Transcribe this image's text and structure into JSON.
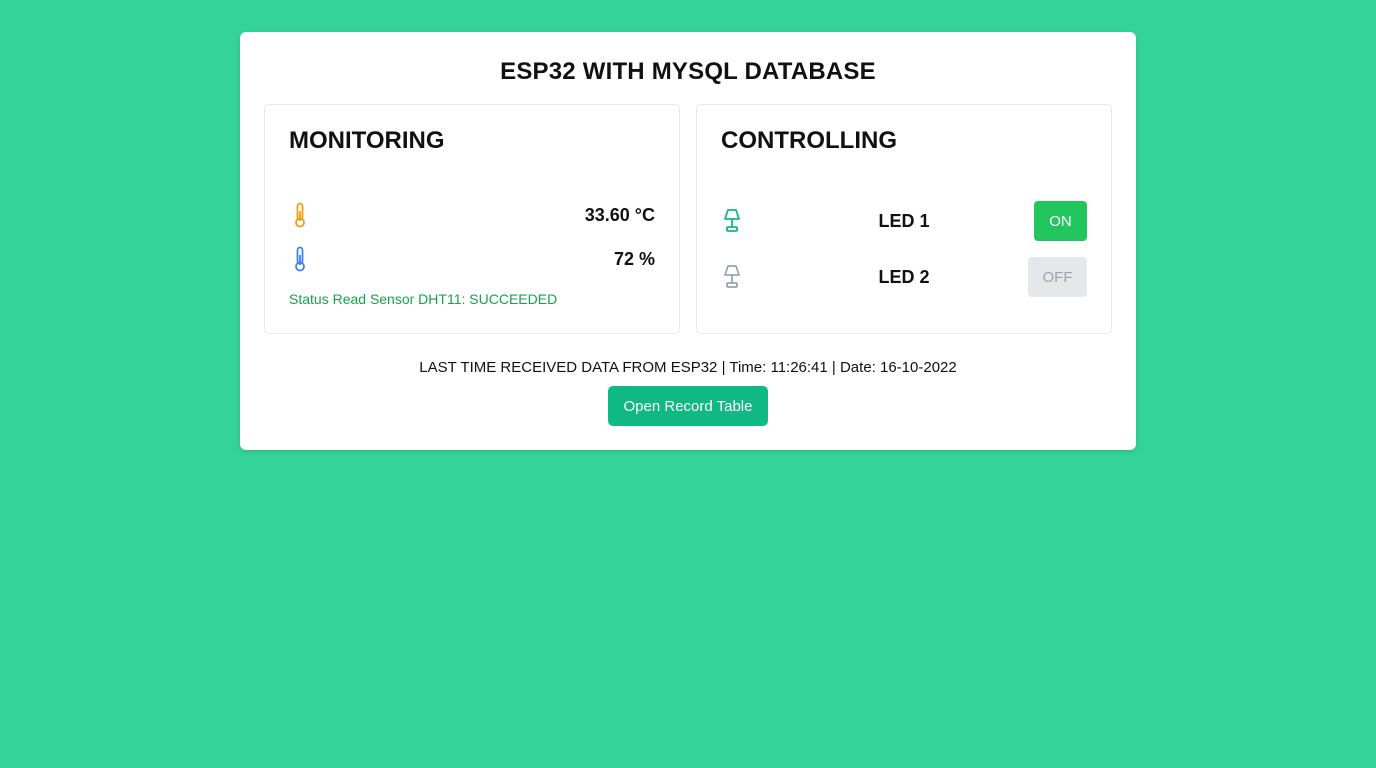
{
  "header": {
    "title": "ESP32 WITH MYSQL DATABASE"
  },
  "monitoring": {
    "title": "MONITORING",
    "temperature": {
      "icon": "thermometer-icon",
      "icon_color": "#f59e0b",
      "value": "33.60 °C"
    },
    "humidity": {
      "icon": "thermometer-icon",
      "icon_color": "#3b82f6",
      "value": "72 %"
    },
    "status": "Status Read Sensor DHT11: SUCCEEDED",
    "status_color": "#16a34a"
  },
  "controlling": {
    "title": "CONTROLLING",
    "leds": [
      {
        "icon": "lamp-icon",
        "icon_color": "#10b981",
        "label": "LED 1",
        "state": "ON",
        "state_color": "#22c55e"
      },
      {
        "icon": "lamp-icon",
        "icon_color": "#9ca3af",
        "label": "LED 2",
        "state": "OFF",
        "state_color": "#e5e7eb"
      }
    ]
  },
  "footer": {
    "last_time": "LAST TIME RECEIVED DATA FROM ESP32 | Time: 11:26:41 | Date: 16-10-2022",
    "record_button": "Open Record Table"
  },
  "colors": {
    "background": "#34d399",
    "accent": "#10b981"
  }
}
